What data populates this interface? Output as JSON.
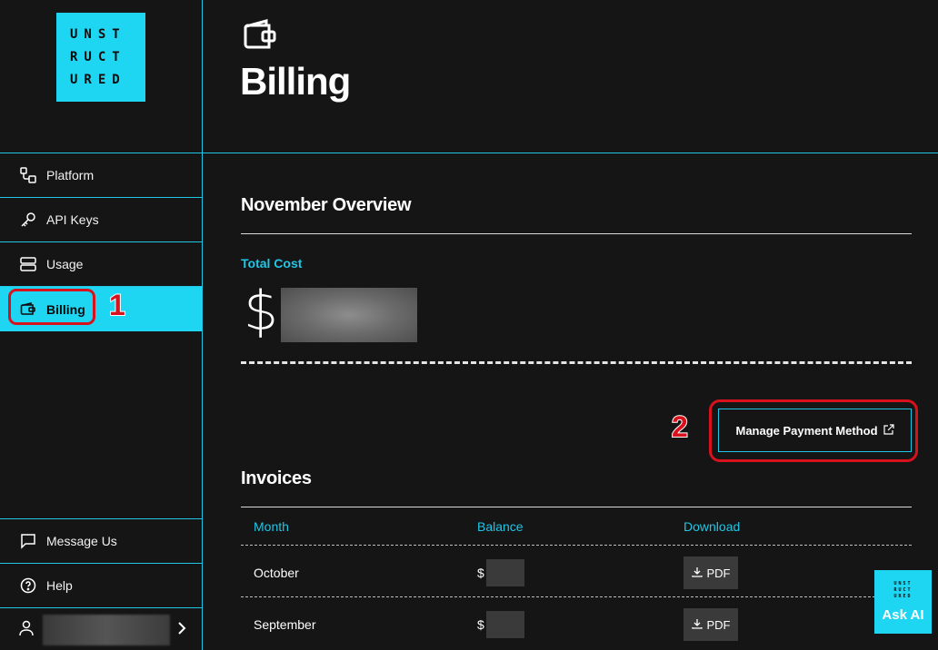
{
  "brand": {
    "logo_lines": [
      "UNST",
      "RUCT",
      "URED"
    ]
  },
  "sidebar": {
    "items": [
      {
        "label": "Platform",
        "icon": "platform-icon"
      },
      {
        "label": "API Keys",
        "icon": "key-icon"
      },
      {
        "label": "Usage",
        "icon": "usage-icon"
      },
      {
        "label": "Billing",
        "icon": "wallet-icon",
        "active": true
      }
    ],
    "bottom": [
      {
        "label": "Message Us",
        "icon": "chat-icon"
      },
      {
        "label": "Help",
        "icon": "help-icon"
      }
    ]
  },
  "annotations": {
    "marker1": "1",
    "marker2": "2"
  },
  "page": {
    "title": "Billing",
    "icon": "wallet-icon"
  },
  "overview": {
    "title": "November Overview",
    "total_cost_label": "Total Cost",
    "currency": "$"
  },
  "actions": {
    "manage_payment": "Manage Payment Method"
  },
  "invoices": {
    "title": "Invoices",
    "columns": [
      "Month",
      "Balance",
      "Download"
    ],
    "rows": [
      {
        "month": "October",
        "currency": "$",
        "download": "PDF"
      },
      {
        "month": "September",
        "currency": "$",
        "download": "PDF"
      }
    ]
  },
  "ask_ai": {
    "label": "Ask AI",
    "mini_logo": [
      "UNST",
      "RUCT",
      "URED"
    ]
  },
  "colors": {
    "accent": "#1ed6f2",
    "background": "#151516",
    "annotation": "#d8121d"
  }
}
